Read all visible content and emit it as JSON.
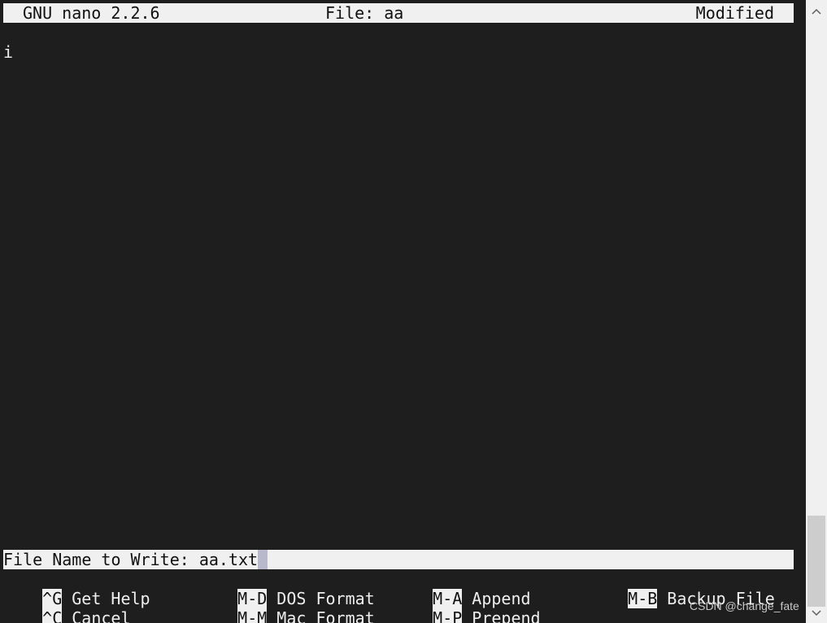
{
  "titlebar": {
    "version": "GNU nano 2.2.6",
    "file": "File: aa",
    "status": "Modified"
  },
  "editor": {
    "lines": [
      "i"
    ]
  },
  "prompt": {
    "label": "File Name to Write: ",
    "value": "aa.txt"
  },
  "shortcuts": [
    {
      "key": "^G",
      "label": "Get Help"
    },
    {
      "key": "M-D",
      "label": "DOS Format"
    },
    {
      "key": "M-A",
      "label": "Append"
    },
    {
      "key": "M-B",
      "label": "Backup File"
    },
    {
      "key": "^C",
      "label": "Cancel"
    },
    {
      "key": "M-M",
      "label": "Mac Format"
    },
    {
      "key": "M-P",
      "label": "Prepend"
    }
  ],
  "scrollbar": {
    "up_icon": "chevron-up-icon",
    "down_icon": "chevron-down-icon"
  },
  "watermark": "CSDN @change_fate",
  "colors": {
    "background": "#1e1e1e",
    "bar": "#f0f0f0",
    "text": "#eeeeee",
    "cursor": "#b9b9cc"
  }
}
